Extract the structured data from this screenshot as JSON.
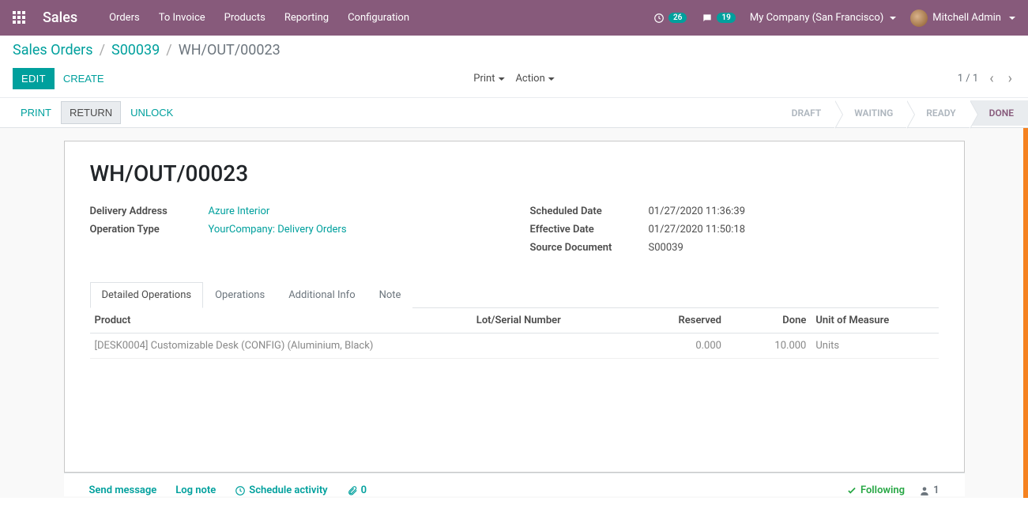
{
  "topbar": {
    "brand": "Sales",
    "nav": [
      "Orders",
      "To Invoice",
      "Products",
      "Reporting",
      "Configuration"
    ],
    "activity_count": "26",
    "messages_count": "19",
    "company": "My Company (San Francisco)",
    "user": "Mitchell Admin"
  },
  "breadcrumb": {
    "root": "Sales Orders",
    "parent": "S00039",
    "current": "WH/OUT/00023"
  },
  "buttons": {
    "edit": "EDIT",
    "create": "CREATE",
    "print_menu": "Print",
    "action_menu": "Action",
    "print": "PRINT",
    "return": "RETURN",
    "unlock": "UNLOCK"
  },
  "pager": {
    "text": "1 / 1"
  },
  "status": {
    "steps": [
      "DRAFT",
      "WAITING",
      "READY",
      "DONE"
    ],
    "active_index": 3
  },
  "record": {
    "title": "WH/OUT/00023",
    "delivery_address_label": "Delivery Address",
    "delivery_address": "Azure Interior",
    "operation_type_label": "Operation Type",
    "operation_type": "YourCompany: Delivery Orders",
    "scheduled_date_label": "Scheduled Date",
    "scheduled_date": "01/27/2020 11:36:39",
    "effective_date_label": "Effective Date",
    "effective_date": "01/27/2020 11:50:18",
    "source_doc_label": "Source Document",
    "source_doc": "S00039"
  },
  "tabs": [
    "Detailed Operations",
    "Operations",
    "Additional Info",
    "Note"
  ],
  "table": {
    "headers": {
      "product": "Product",
      "lot": "Lot/Serial Number",
      "reserved": "Reserved",
      "done": "Done",
      "uom": "Unit of Measure"
    },
    "rows": [
      {
        "product": "[DESK0004] Customizable Desk (CONFIG) (Aluminium, Black)",
        "lot": "",
        "reserved": "0.000",
        "done": "10.000",
        "uom": "Units"
      }
    ]
  },
  "chatter": {
    "send": "Send message",
    "log": "Log note",
    "schedule": "Schedule activity",
    "attach_count": "0",
    "following": "Following",
    "followers": "1"
  }
}
